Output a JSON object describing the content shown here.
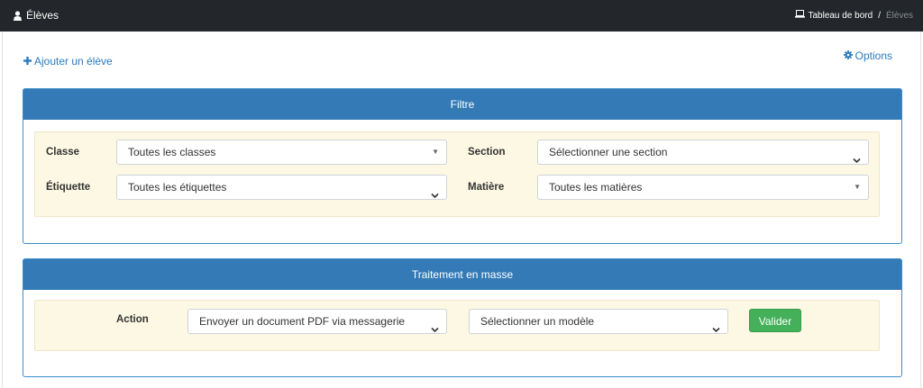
{
  "header": {
    "title": "Élèves",
    "title_icon": "user-icon",
    "breadcrumb": {
      "home_label": "Tableau de bord",
      "home_icon": "laptop-icon",
      "separator": "/",
      "current": "Élèves"
    }
  },
  "toolbar": {
    "add_label": "Ajouter un élève",
    "add_icon": "plus-icon",
    "options_label": "Options",
    "options_icon": "gear-icon"
  },
  "filter": {
    "title": "Filtre",
    "classe_label": "Classe",
    "classe_value": "Toutes les classes",
    "section_label": "Section",
    "section_value": "Sélectionner une section",
    "etiquette_label": "Étiquette",
    "etiquette_value": "Toutes les étiquettes",
    "matiere_label": "Matière",
    "matiere_value": "Toutes les matières"
  },
  "bulk": {
    "title": "Traitement en masse",
    "action_label": "Action",
    "action_value": "Envoyer un document PDF via messagerie",
    "model_value": "Sélectionner un modèle",
    "submit_label": "Valider"
  },
  "colors": {
    "topbar": "#23272b",
    "panel_header": "#337ab7",
    "link": "#2a7bbf",
    "well": "#fcf8e3",
    "success": "#45b05a"
  }
}
